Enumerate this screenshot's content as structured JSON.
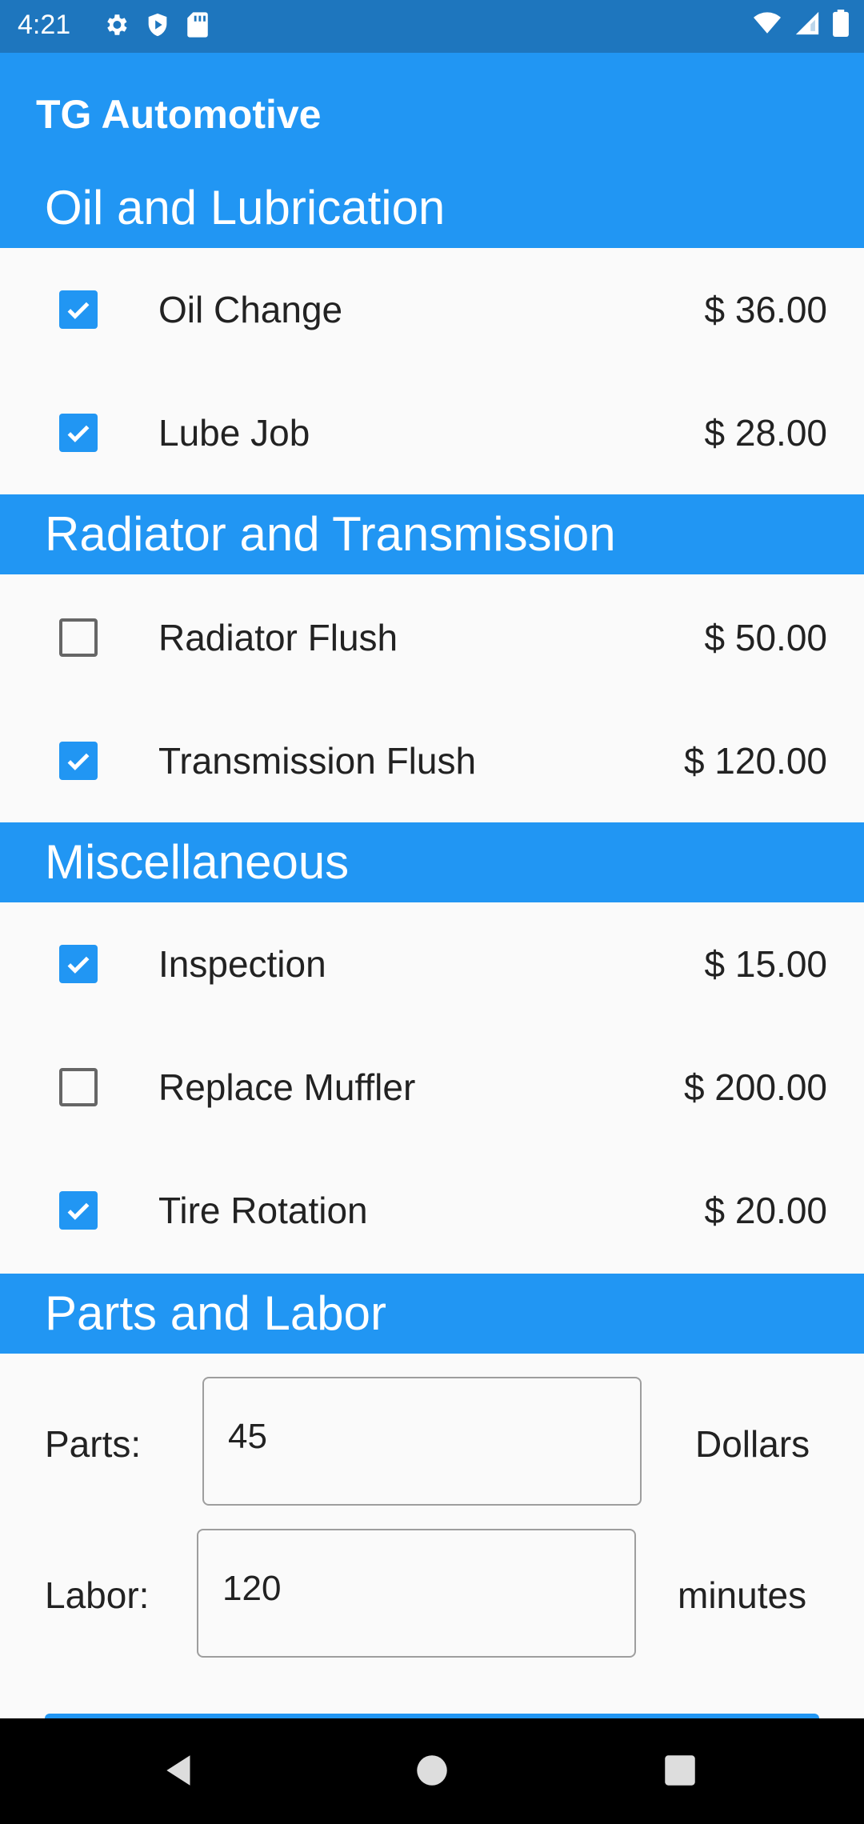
{
  "status_bar": {
    "time": "4:21",
    "left_icons": [
      "gear-icon",
      "shield-icon",
      "sd-card-icon"
    ],
    "right_icons": [
      "wifi-icon",
      "signal-icon",
      "battery-icon"
    ]
  },
  "app_bar": {
    "title": "TG Automotive"
  },
  "sections": {
    "oil": {
      "title": "Oil and Lubrication",
      "items": [
        {
          "label": "Oil Change",
          "price": "$ 36.00",
          "checked": true
        },
        {
          "label": "Lube Job",
          "price": "$ 28.00",
          "checked": true
        }
      ]
    },
    "radiator": {
      "title": "Radiator and Transmission",
      "items": [
        {
          "label": "Radiator Flush",
          "price": "$ 50.00",
          "checked": false
        },
        {
          "label": "Transmission Flush",
          "price": "$ 120.00",
          "checked": true
        }
      ]
    },
    "misc": {
      "title": "Miscellaneous",
      "items": [
        {
          "label": "Inspection",
          "price": "$ 15.00",
          "checked": true
        },
        {
          "label": "Replace Muffler",
          "price": "$ 200.00",
          "checked": false
        },
        {
          "label": "Tire Rotation",
          "price": "$ 20.00",
          "checked": true
        }
      ]
    },
    "parts_labor": {
      "title": "Parts and Labor",
      "parts": {
        "label": "Parts:",
        "value": "45",
        "unit": "Dollars"
      },
      "labor": {
        "label": "Labor:",
        "value": "120",
        "unit": "minutes"
      }
    }
  },
  "colors": {
    "primary": "#2196F3",
    "status_bar": "#1E76BE",
    "background": "#FAFAFA"
  },
  "nav_bar": {
    "buttons": [
      "back-icon",
      "home-icon",
      "recents-icon"
    ]
  }
}
